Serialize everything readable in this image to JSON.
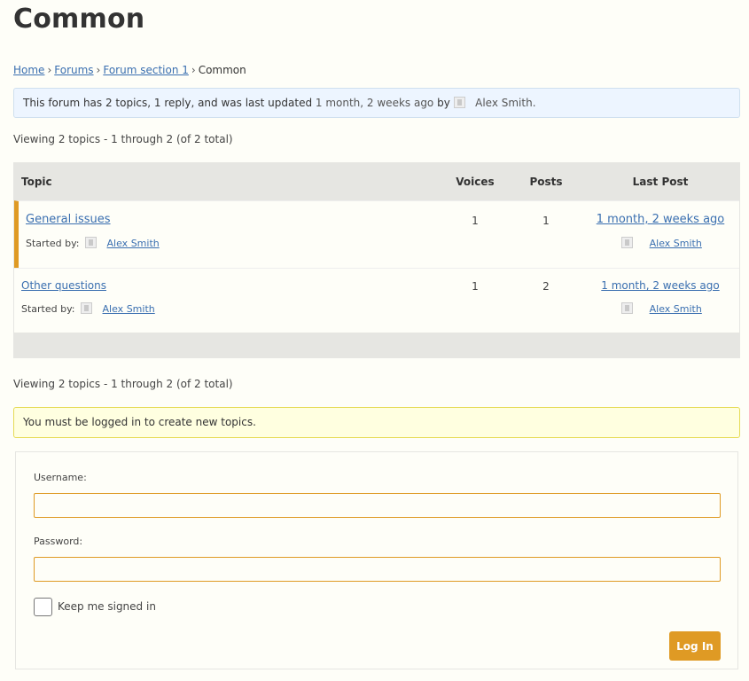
{
  "page": {
    "title": "Common"
  },
  "breadcrumb": {
    "items": [
      {
        "label": "Home",
        "link": true
      },
      {
        "label": "Forums",
        "link": true
      },
      {
        "label": "Forum section 1",
        "link": true
      },
      {
        "label": "Common",
        "link": false
      }
    ],
    "separator": "›"
  },
  "info": {
    "prefix": "This forum has 2 topics, 1 reply, and was last updated",
    "time": "1 month, 2 weeks ago",
    "by": "by",
    "author": "Alex Smith."
  },
  "pagination": {
    "summary": "Viewing 2 topics - 1 through 2 (of 2 total)"
  },
  "table": {
    "headers": {
      "topic": "Topic",
      "voices": "Voices",
      "posts": "Posts",
      "last_post": "Last Post"
    },
    "rows": [
      {
        "title": "General issues",
        "started_label": "Started by:",
        "author": "Alex Smith",
        "voices": "1",
        "posts": "1",
        "last_time": "1 month, 2 weeks ago",
        "last_author": "Alex Smith",
        "sticky": true
      },
      {
        "title": "Other questions",
        "started_label": "Started by:",
        "author": "Alex Smith",
        "voices": "1",
        "posts": "2",
        "last_time": "1 month, 2 weeks ago",
        "last_author": "Alex Smith",
        "sticky": false
      }
    ]
  },
  "notice": {
    "text": "You must be logged in to create new topics."
  },
  "login": {
    "username_label": "Username:",
    "username_value": "",
    "password_label": "Password:",
    "password_value": "",
    "remember_label": "Keep me signed in",
    "remember_checked": false,
    "submit_label": "Log In"
  },
  "colors": {
    "accent": "#df9a24",
    "link": "#3a6fb0",
    "info_bg": "#edf5ff",
    "notice_bg": "#ffffe0"
  }
}
